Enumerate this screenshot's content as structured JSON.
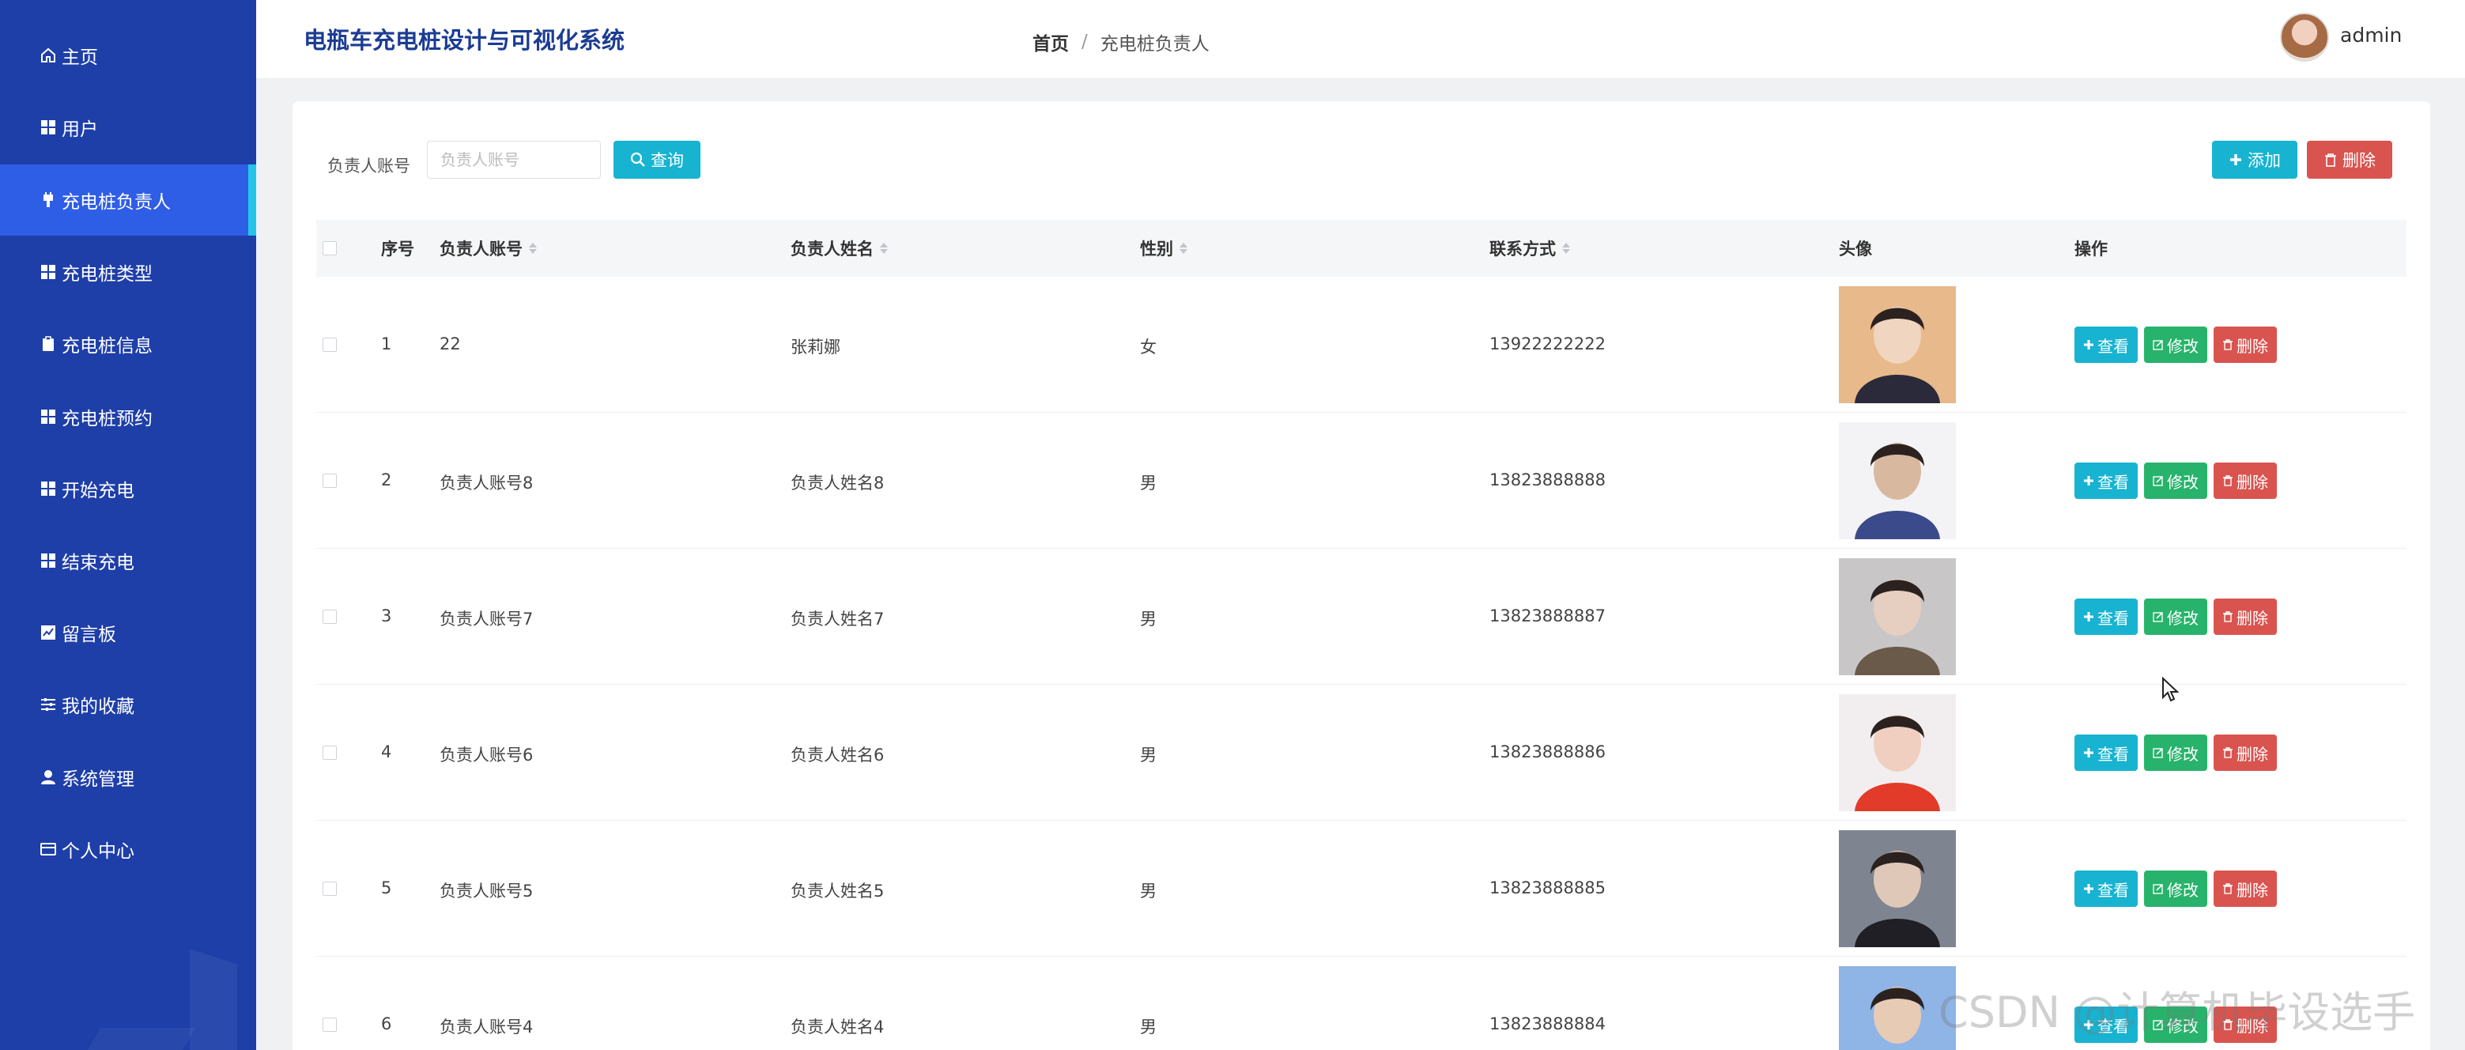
{
  "app": {
    "title": "电瓶车充电桩设计与可视化系统"
  },
  "breadcrumb": {
    "home": "首页",
    "separator": "/",
    "current": "充电桩负责人"
  },
  "user": {
    "name": "admin"
  },
  "sidebar": {
    "items": [
      {
        "label": "主页",
        "icon": "home-icon"
      },
      {
        "label": "用户",
        "icon": "grid-icon"
      },
      {
        "label": "充电桩负责人",
        "icon": "plug-icon",
        "active": true
      },
      {
        "label": "充电桩类型",
        "icon": "grid-icon"
      },
      {
        "label": "充电桩信息",
        "icon": "clipboard-icon"
      },
      {
        "label": "充电桩预约",
        "icon": "grid-icon"
      },
      {
        "label": "开始充电",
        "icon": "grid-icon"
      },
      {
        "label": "结束充电",
        "icon": "grid-icon"
      },
      {
        "label": "留言板",
        "icon": "chart-icon"
      },
      {
        "label": "我的收藏",
        "icon": "sliders-icon"
      },
      {
        "label": "系统管理",
        "icon": "user-icon"
      },
      {
        "label": "个人中心",
        "icon": "card-icon"
      }
    ]
  },
  "search": {
    "label": "负责人账号",
    "placeholder": "负责人账号",
    "value": "",
    "query_button": "查询"
  },
  "toolbar": {
    "add_button": "添加",
    "delete_button": "删除"
  },
  "table": {
    "columns": [
      "序号",
      "负责人账号",
      "负责人姓名",
      "性别",
      "联系方式",
      "头像",
      "操作"
    ],
    "actions": {
      "view": "查看",
      "edit": "修改",
      "delete": "删除"
    },
    "rows": [
      {
        "index": "1",
        "account": "22",
        "name": "张莉娜",
        "gender": "女",
        "phone": "13922222222"
      },
      {
        "index": "2",
        "account": "负责人账号8",
        "name": "负责人姓名8",
        "gender": "男",
        "phone": "13823888888"
      },
      {
        "index": "3",
        "account": "负责人账号7",
        "name": "负责人姓名7",
        "gender": "男",
        "phone": "13823888887"
      },
      {
        "index": "4",
        "account": "负责人账号6",
        "name": "负责人姓名6",
        "gender": "男",
        "phone": "13823888886"
      },
      {
        "index": "5",
        "account": "负责人账号5",
        "name": "负责人姓名5",
        "gender": "男",
        "phone": "13823888885"
      },
      {
        "index": "6",
        "account": "负责人账号4",
        "name": "负责人姓名4",
        "gender": "男",
        "phone": "13823888884"
      }
    ]
  },
  "watermark": "CSDN @计算机毕设选手",
  "colors": {
    "sidebar": "#1e3fa8",
    "sidebar_active": "#2f5ee6",
    "accent": "#17b3d1",
    "success": "#27b36b",
    "danger": "#d9534f",
    "title": "#1b3c93"
  }
}
